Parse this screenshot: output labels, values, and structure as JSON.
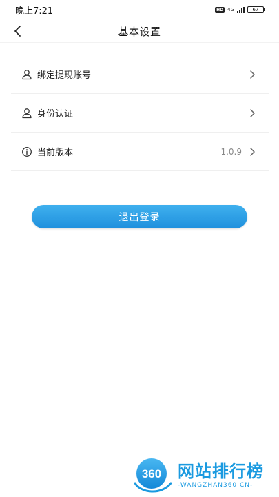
{
  "status_bar": {
    "time": "晚上7:21",
    "hd": "HD",
    "network": "4G",
    "battery": "67"
  },
  "header": {
    "back_icon": "chevron-left-icon",
    "title": "基本设置"
  },
  "settings": {
    "items": [
      {
        "icon": "user-icon",
        "label": "绑定提现账号",
        "value": ""
      },
      {
        "icon": "user-icon",
        "label": "身份认证",
        "value": ""
      },
      {
        "icon": "info-icon",
        "label": "当前版本",
        "value": "1.0.9"
      }
    ]
  },
  "logout": {
    "label": "退出登录"
  },
  "watermark": {
    "logo_text": "360",
    "title": "网站排行榜",
    "subtitle": "-WANGZHAN360.CN-"
  },
  "colors": {
    "accent": "#2a9fe6",
    "watermark": "#1a9ae0"
  }
}
